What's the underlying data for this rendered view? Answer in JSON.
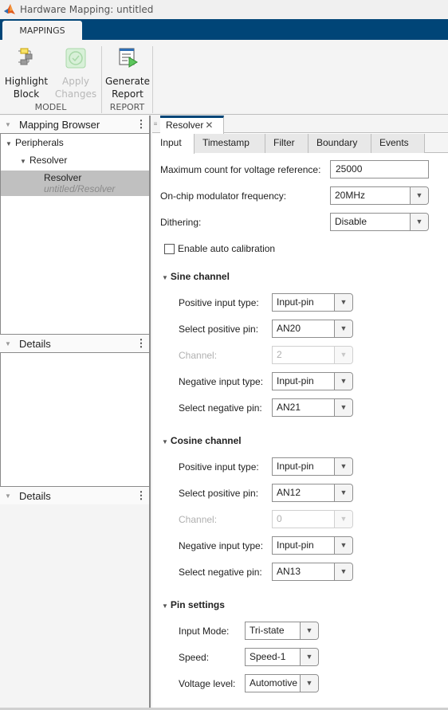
{
  "window": {
    "title": "Hardware Mapping: untitled"
  },
  "ribbon": {
    "tab": "MAPPINGS",
    "buttons": {
      "highlight_block": {
        "line1": "Highlight",
        "line2": "Block"
      },
      "apply_changes": {
        "line1": "Apply",
        "line2": "Changes"
      },
      "generate_report": {
        "line1": "Generate",
        "line2": "Report"
      }
    },
    "groups": {
      "model": "MODEL",
      "report": "REPORT"
    }
  },
  "left": {
    "mapping_browser": {
      "title": "Mapping Browser",
      "tree": {
        "root": "Peripherals",
        "child": "Resolver",
        "leaf_name": "Resolver",
        "leaf_path": "untitled/Resolver"
      }
    },
    "details1": {
      "title": "Details"
    },
    "details2": {
      "title": "Details"
    }
  },
  "doc": {
    "tab": "Resolver",
    "subtabs": [
      "Input",
      "Timestamp",
      "Filter",
      "Boundary",
      "Events"
    ],
    "active_subtab": "Input",
    "general": {
      "max_count_label": "Maximum count for voltage reference:",
      "max_count_value": "25000",
      "mod_freq_label": "On-chip modulator frequency:",
      "mod_freq_value": "20MHz",
      "dithering_label": "Dithering:",
      "dithering_value": "Disable",
      "auto_cal_label": "Enable auto calibration",
      "auto_cal_checked": false
    },
    "sine": {
      "title": "Sine channel",
      "pos_type_label": "Positive input type:",
      "pos_type_value": "Input-pin",
      "pos_pin_label": "Select positive pin:",
      "pos_pin_value": "AN20",
      "channel_label": "Channel:",
      "channel_value": "2",
      "neg_type_label": "Negative input type:",
      "neg_type_value": "Input-pin",
      "neg_pin_label": "Select negative pin:",
      "neg_pin_value": "AN21"
    },
    "cosine": {
      "title": "Cosine channel",
      "pos_type_label": "Positive input type:",
      "pos_type_value": "Input-pin",
      "pos_pin_label": "Select positive pin:",
      "pos_pin_value": "AN12",
      "channel_label": "Channel:",
      "channel_value": "0",
      "neg_type_label": "Negative input type:",
      "neg_type_value": "Input-pin",
      "neg_pin_label": "Select negative pin:",
      "neg_pin_value": "AN13"
    },
    "pins": {
      "title": "Pin settings",
      "mode_label": "Input Mode:",
      "mode_value": "Tri-state",
      "speed_label": "Speed:",
      "speed_value": "Speed-1",
      "voltage_label": "Voltage level:",
      "voltage_value": "Automotive"
    }
  },
  "colors": {
    "ribbon_bar": "#004577",
    "selection": "#c0c0c0"
  }
}
